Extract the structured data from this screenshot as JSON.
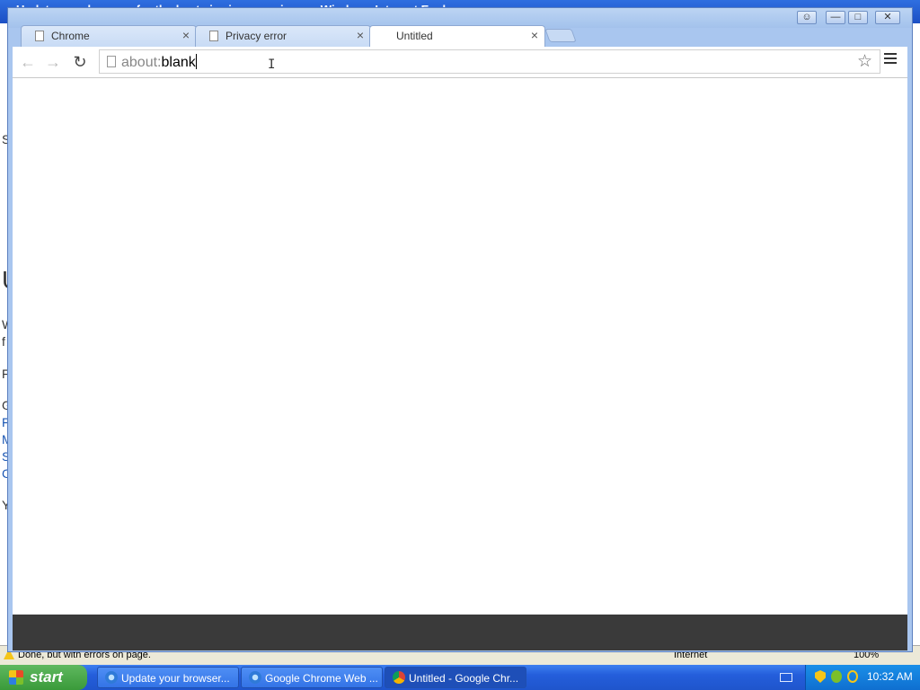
{
  "background": {
    "title": "Update your browser for the best viewing experience - Windows Internet Explorer",
    "body_letters": [
      "S",
      "U",
      "W",
      "f",
      "F",
      "G",
      "F",
      "M",
      "S",
      "C",
      "Y"
    ],
    "status_text": "Done, but with errors on page.",
    "status_zone": "Internet",
    "status_zoom": "100%"
  },
  "window": {
    "controls": {
      "user": "☺",
      "minimize": "—",
      "maximize": "□",
      "close": "✕"
    }
  },
  "tabs": [
    {
      "label": "Chrome",
      "close": "×",
      "active": false
    },
    {
      "label": "Privacy error",
      "close": "×",
      "active": false
    },
    {
      "label": "Untitled",
      "close": "×",
      "active": true
    }
  ],
  "toolbar": {
    "back": "←",
    "forward": "→",
    "reload": "↻",
    "address_scheme": "about:",
    "address_path": "blank",
    "star": "☆"
  },
  "taskbar": {
    "start_label": "start",
    "items": [
      {
        "label": "Update your browser...",
        "icon": "ie-icon",
        "active": false
      },
      {
        "label": "Google Chrome Web ...",
        "icon": "ie-icon",
        "active": false
      },
      {
        "label": "Untitled - Google Chr...",
        "icon": "chrome-icon",
        "active": true
      }
    ],
    "clock": "10:32 AM"
  },
  "colors": {
    "taskbar": "#245edb",
    "start": "#3a9a3a",
    "chrome_frame": "#a9c6ef"
  }
}
